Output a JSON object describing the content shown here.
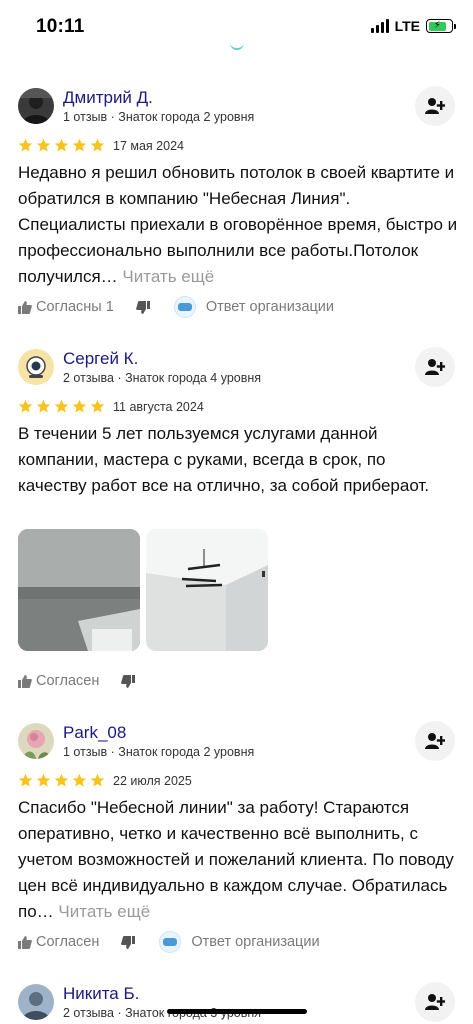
{
  "status": {
    "time": "10:11",
    "network": "LTE"
  },
  "reviews": [
    {
      "author": "Дмитрий Д.",
      "meta": "1 отзыв · Знаток города 2 уровня",
      "date": "17 мая 2024",
      "text": "Недавно я решил обновить потолок в своей квартите и обратился в компанию \"Небесная Линия\". Специалисты приехали в оговорённое время, быстро и профессионально выполнили все работы.Потолок получился… ",
      "read_more": "Читать ещё",
      "agree": "Согласны 1",
      "org_reply": "Ответ организации"
    },
    {
      "author": "Сергей К.",
      "meta": "2 отзыва · Знаток города 4 уровня",
      "date": "11 августа 2024",
      "text": "В течении 5 лет пользуемся услугами данной компании, мастера с руками, всегда в срок, по качеству работ все на отлично, за собой прибераот.",
      "agree": "Согласен"
    },
    {
      "author": "Park_08",
      "meta": "1 отзыв · Знаток города 2 уровня",
      "date": "22 июля 2025",
      "text": "Спасибо \"Небесной линии\" за работу! Стараются оперативно, четко и качественно всё выполнить, с учетом возможностей и пожеланий клиента. По поводу цен всё индивидуально в каждом случае. Обратилась по… ",
      "read_more": "Читать ещё",
      "agree": "Согласен",
      "org_reply": "Ответ организации"
    },
    {
      "author": "Никита Б.",
      "meta": "2 отзыва · Знаток города 3 уровня"
    }
  ],
  "colors": {
    "author": "#1a1a80",
    "star": "#f7c31c",
    "muted": "#7a7a7a"
  }
}
